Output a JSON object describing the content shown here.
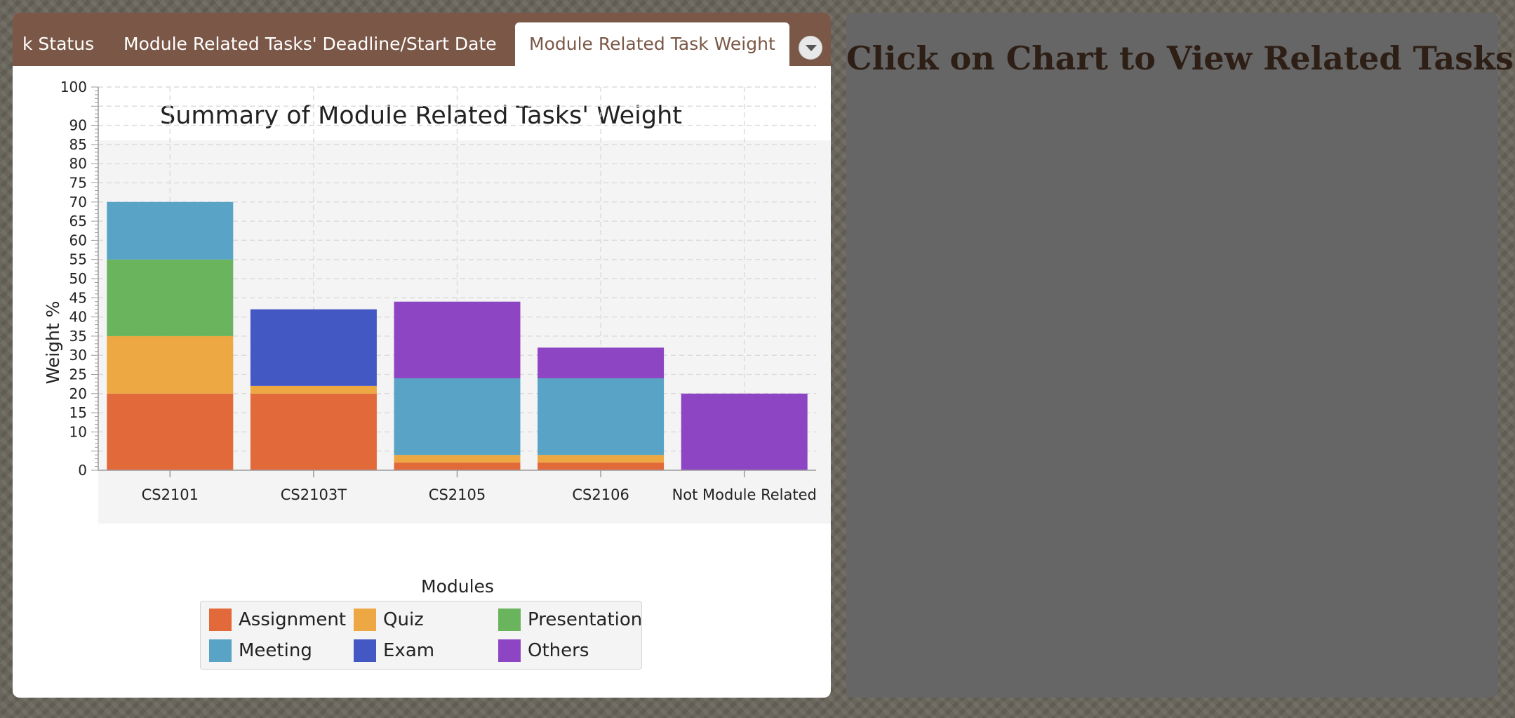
{
  "tabs": [
    {
      "label": "k Status",
      "selected": false
    },
    {
      "label": "Module Related Tasks' Deadline/Start Date",
      "selected": false
    },
    {
      "label": "Module Related Task Weight",
      "selected": true
    }
  ],
  "dropdown_icon": "chevron-down-icon",
  "right_panel": {
    "title": "Click on Chart to View Related Tasks"
  },
  "colors": {
    "tab_bar": "#7a5746",
    "right_panel": "#666666",
    "Assignment": "#e2693a",
    "Quiz": "#eda743",
    "Presentation": "#6ab45e",
    "Meeting": "#58a3c6",
    "Exam": "#4458c4",
    "Others": "#8e45c3"
  },
  "chart_data": {
    "type": "bar",
    "stacked": true,
    "title": "Summary of Module Related Tasks' Weight",
    "xlabel": "Modules",
    "ylabel": "Weight %",
    "ylim": [
      0,
      100
    ],
    "yticks": [
      0,
      10,
      15,
      20,
      25,
      30,
      35,
      40,
      45,
      50,
      55,
      60,
      65,
      70,
      75,
      80,
      85,
      90,
      100
    ],
    "grid": true,
    "legend_position": "bottom",
    "categories": [
      "CS2101",
      "CS2103T",
      "CS2105",
      "CS2106",
      "Not Module Related"
    ],
    "series": [
      {
        "name": "Assignment",
        "values": [
          20,
          20,
          2,
          2,
          0
        ]
      },
      {
        "name": "Quiz",
        "values": [
          15,
          2,
          2,
          2,
          0
        ]
      },
      {
        "name": "Presentation",
        "values": [
          20,
          0,
          0,
          0,
          0
        ]
      },
      {
        "name": "Meeting",
        "values": [
          15,
          0,
          20,
          20,
          0
        ]
      },
      {
        "name": "Exam",
        "values": [
          0,
          20,
          0,
          0,
          0
        ]
      },
      {
        "name": "Others",
        "values": [
          0,
          0,
          20,
          8,
          20
        ]
      }
    ]
  }
}
